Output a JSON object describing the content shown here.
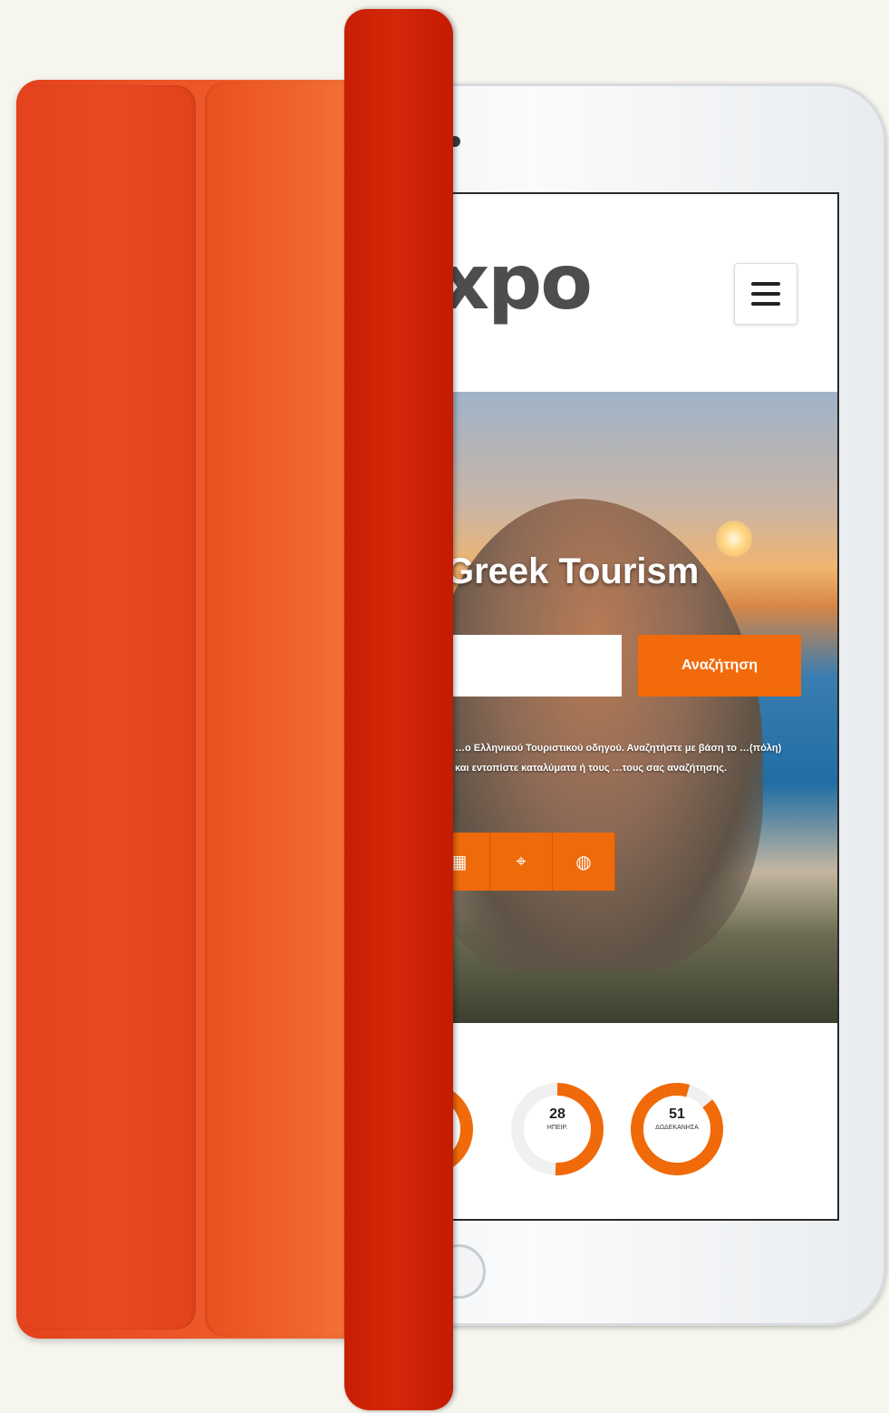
{
  "site": {
    "logo_text": "xpo",
    "menu_icon": "hamburger-icon"
  },
  "hero": {
    "title": "Greek Tourism",
    "search_placeholder": "",
    "search_button": "Αναζήτηση",
    "description": "…ο Ελληνικού Τουριστικού οδηγού. Αναζητήστε με βάση το …(πόλη) και εντοπίστε καταλύματα ή τους …τους σας αναζήτησης.",
    "icons": [
      "grid-icon",
      "location-icon",
      "globe-icon"
    ]
  },
  "stats": [
    {
      "number": "",
      "label": ""
    },
    {
      "number": "28",
      "label": "ΗΠΕΙΡ."
    },
    {
      "number": "51",
      "label": "ΔΩΔΕΚΑΝΗΣΑ"
    }
  ],
  "colors": {
    "accent": "#f26a0a",
    "cover": "#e4411c",
    "cover_front": "#c81e04"
  }
}
